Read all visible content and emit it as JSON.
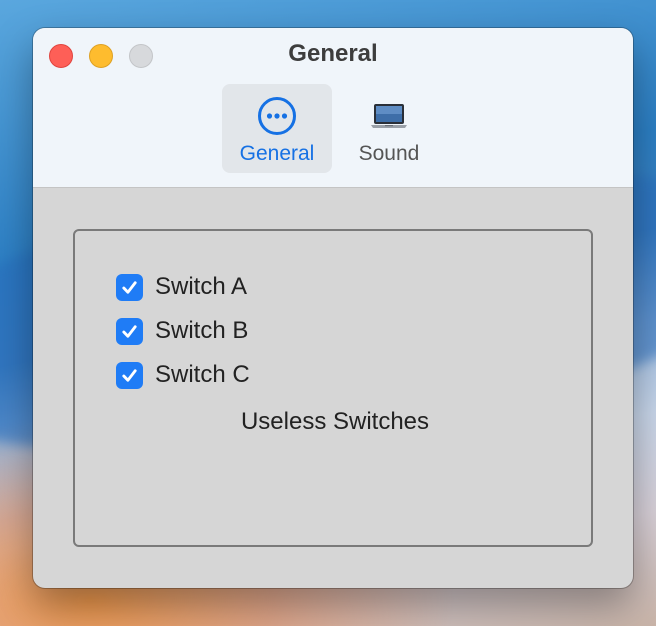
{
  "window": {
    "title": "General"
  },
  "toolbar": {
    "tabs": [
      {
        "label": "General",
        "icon": "ellipsis-circle-icon",
        "selected": true
      },
      {
        "label": "Sound",
        "icon": "laptop-icon",
        "selected": false
      }
    ]
  },
  "group": {
    "checkboxes": [
      {
        "label": "Switch A",
        "checked": true
      },
      {
        "label": "Switch B",
        "checked": true
      },
      {
        "label": "Switch C",
        "checked": true
      }
    ],
    "label": "Useless Switches"
  },
  "colors": {
    "accent": "#1f7cf6",
    "close": "#fe5f57",
    "minimize": "#febc2e"
  }
}
